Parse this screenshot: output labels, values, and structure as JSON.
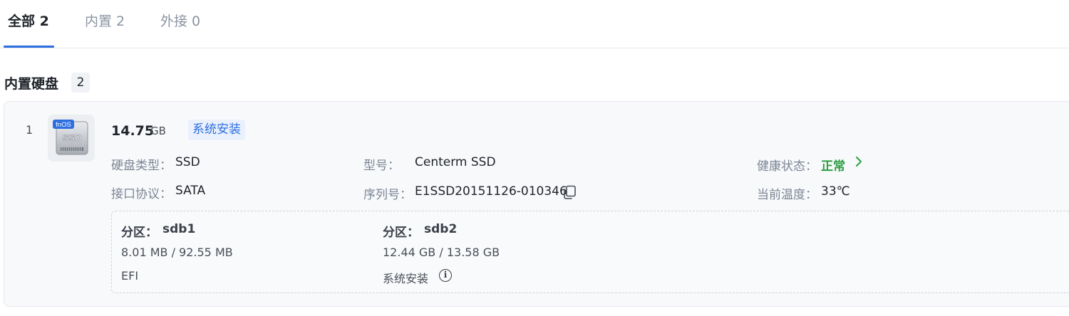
{
  "tabs": [
    {
      "label": "全部 2",
      "active": true
    },
    {
      "label": "内置 2",
      "active": false
    },
    {
      "label": "外接 0",
      "active": false
    }
  ],
  "section": {
    "title": "内置硬盘",
    "count": "2"
  },
  "disk": {
    "index": "1",
    "icon_label": "fnOS",
    "icon_type": "SSD",
    "size_value": "14.75",
    "size_unit": "GB",
    "tag": "系统安装",
    "fields": {
      "type_label": "硬盘类型：",
      "type_value": "SSD",
      "model_label": "型号：",
      "model_value": "Centerm SSD",
      "health_label": "健康状态：",
      "health_value": "正常",
      "iface_label": "接口协议：",
      "iface_value": "SATA",
      "serial_label": "序列号：",
      "serial_value": "E1SSD20151126-010346",
      "temp_label": "当前温度：",
      "temp_value": "33℃"
    },
    "partitions": [
      {
        "title_label": "分区：",
        "name": "sdb1",
        "usage": "8.01 MB / 92.55 MB",
        "note": "EFI"
      },
      {
        "title_label": "分区：",
        "name": "sdb2",
        "usage": "12.44 GB / 13.58 GB",
        "note": "系统安装"
      }
    ]
  },
  "colors": {
    "accent": "#2e6fe0",
    "health_ok": "#2f9e44"
  },
  "icons": [
    "disk-ssd-icon",
    "copy-icon",
    "chevron-right-icon",
    "info-icon"
  ]
}
